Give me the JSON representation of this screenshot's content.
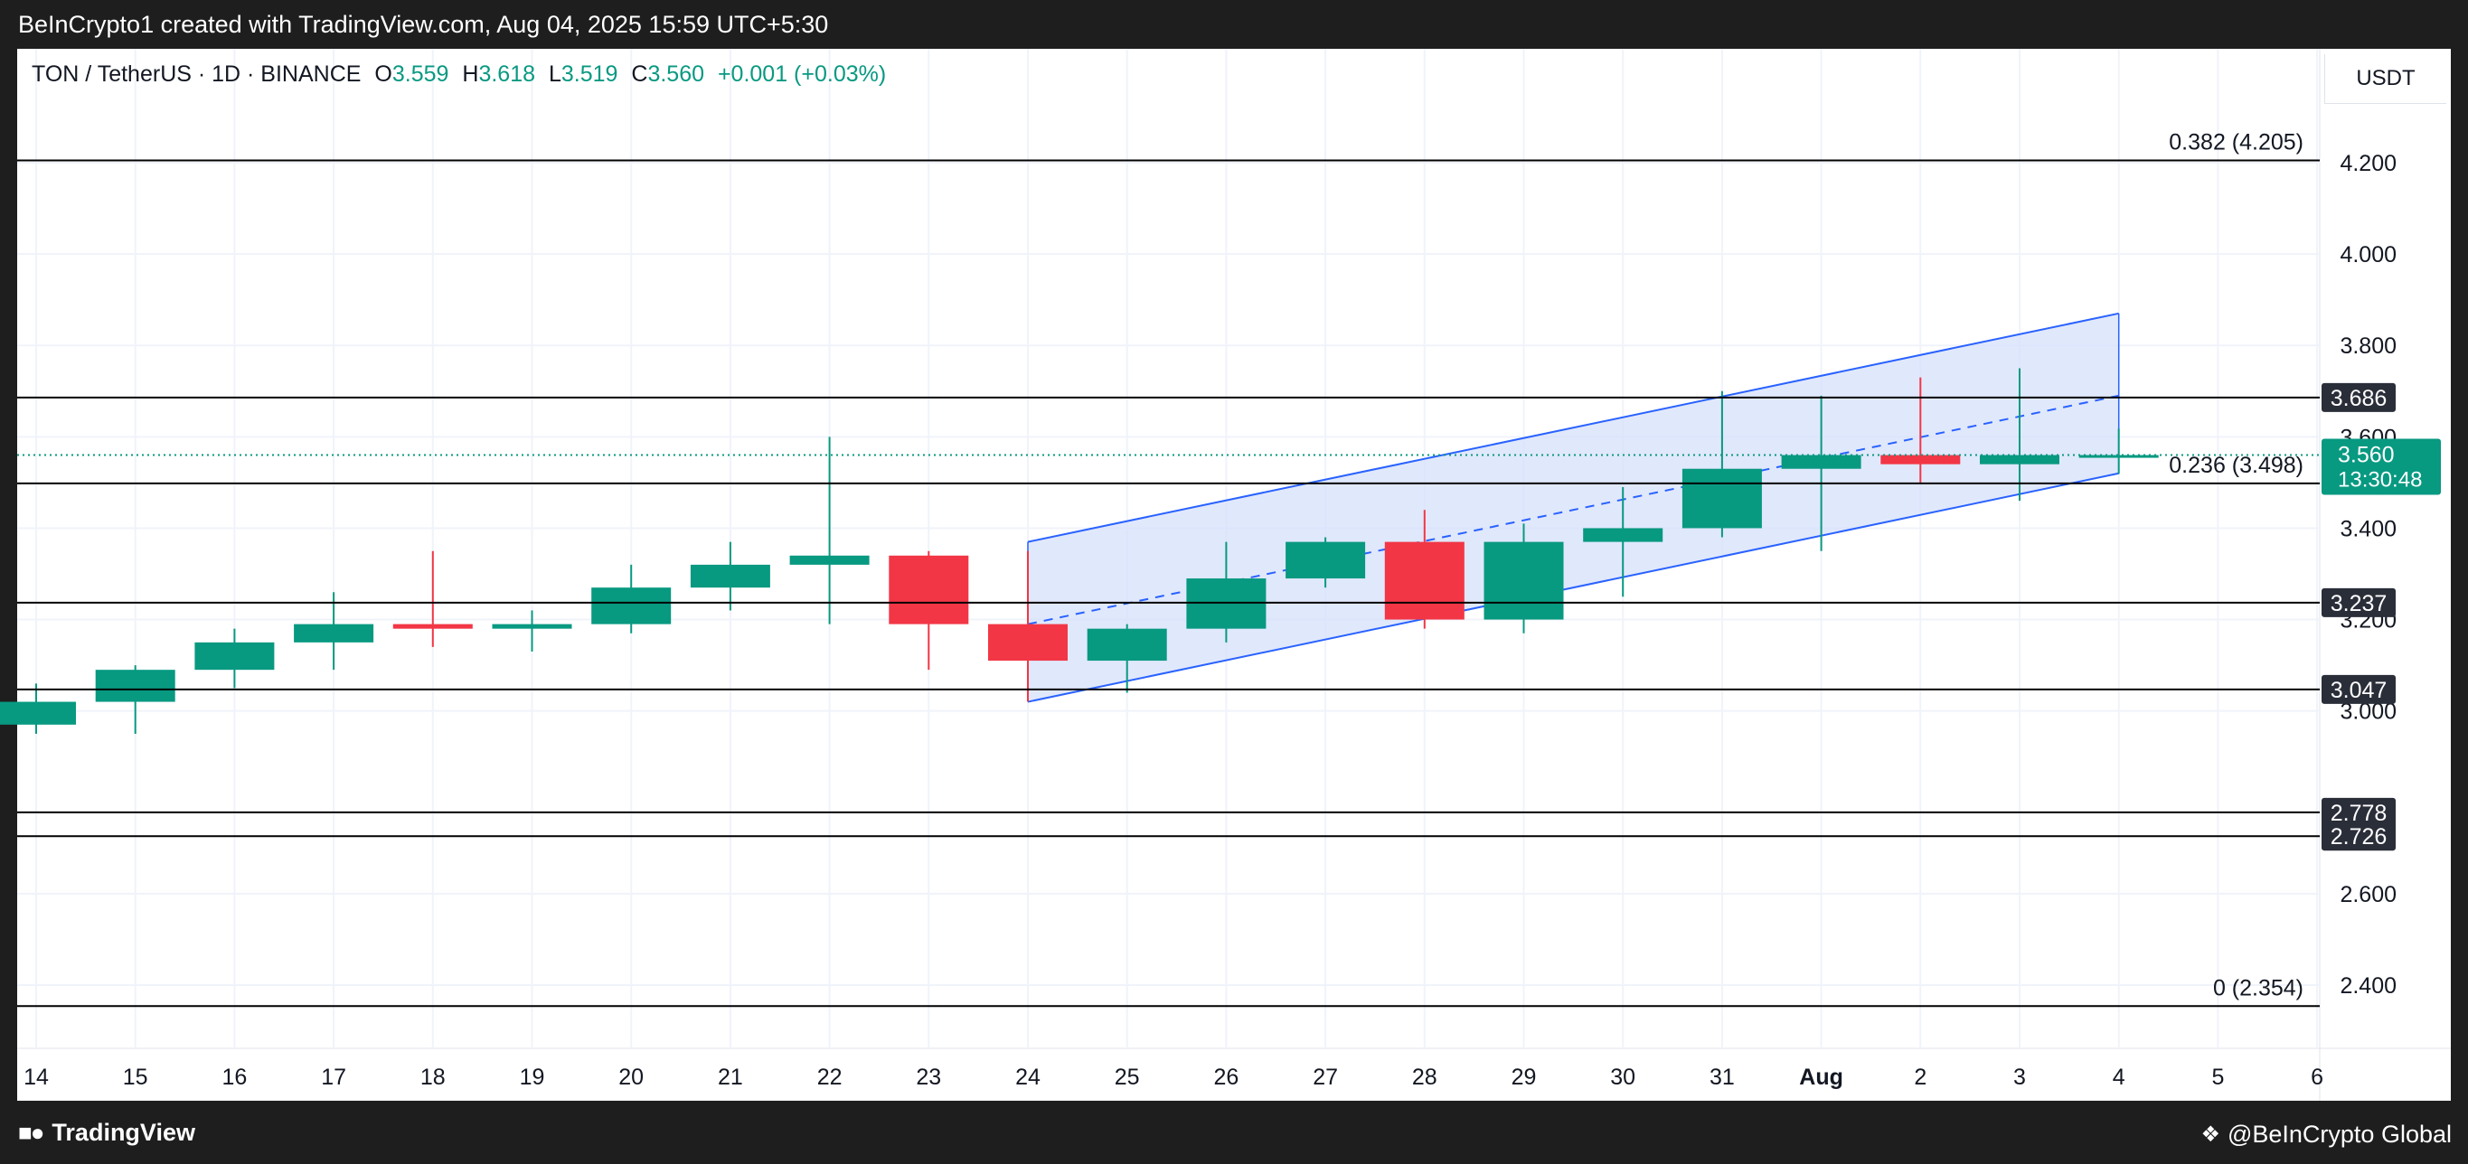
{
  "header": {
    "attribution": "BeInCrypto1 created with TradingView.com, Aug 04, 2025 15:59 UTC+5:30"
  },
  "legend": {
    "symbol": "TON / TetherUS · 1D · BINANCE",
    "o_label": "O",
    "o_value": "3.559",
    "h_label": "H",
    "h_value": "3.618",
    "l_label": "L",
    "l_value": "3.519",
    "c_label": "C",
    "c_value": "3.560",
    "change": "+0.001 (+0.03%)"
  },
  "currency": "USDT",
  "footer": {
    "tradingview": "TradingView",
    "brand": "@BeInCrypto Global"
  },
  "colors": {
    "up": "#089981",
    "down": "#f23645",
    "channel": "#2962ff",
    "channel_fill": "#d6e0fb",
    "level_line": "#000000",
    "badge_dark": "#2a2e39"
  },
  "chart_data": {
    "type": "candlestick",
    "x_labels": [
      "14",
      "15",
      "16",
      "17",
      "18",
      "19",
      "20",
      "21",
      "22",
      "23",
      "24",
      "25",
      "26",
      "27",
      "28",
      "29",
      "30",
      "31",
      "Aug",
      "2",
      "3",
      "4",
      "5",
      "6"
    ],
    "y_ticks": [
      "2.400",
      "2.600",
      "3.000",
      "3.200",
      "3.400",
      "3.600",
      "3.800",
      "4.000",
      "4.200"
    ],
    "ylim": [
      2.23,
      4.55
    ],
    "candles": [
      {
        "x": 0,
        "o": 2.97,
        "h": 3.06,
        "l": 2.95,
        "c": 3.02
      },
      {
        "x": 1,
        "o": 3.02,
        "h": 3.1,
        "l": 2.95,
        "c": 3.09
      },
      {
        "x": 2,
        "o": 3.09,
        "h": 3.18,
        "l": 3.05,
        "c": 3.15
      },
      {
        "x": 3,
        "o": 3.15,
        "h": 3.26,
        "l": 3.09,
        "c": 3.19
      },
      {
        "x": 4,
        "o": 3.19,
        "h": 3.35,
        "l": 3.14,
        "c": 3.18
      },
      {
        "x": 5,
        "o": 3.18,
        "h": 3.22,
        "l": 3.13,
        "c": 3.19
      },
      {
        "x": 6,
        "o": 3.19,
        "h": 3.32,
        "l": 3.17,
        "c": 3.27
      },
      {
        "x": 7,
        "o": 3.27,
        "h": 3.37,
        "l": 3.22,
        "c": 3.32
      },
      {
        "x": 8,
        "o": 3.32,
        "h": 3.6,
        "l": 3.19,
        "c": 3.34
      },
      {
        "x": 9,
        "o": 3.34,
        "h": 3.35,
        "l": 3.09,
        "c": 3.19
      },
      {
        "x": 10,
        "o": 3.19,
        "h": 3.35,
        "l": 3.02,
        "c": 3.11
      },
      {
        "x": 11,
        "o": 3.11,
        "h": 3.19,
        "l": 3.04,
        "c": 3.18
      },
      {
        "x": 12,
        "o": 3.18,
        "h": 3.37,
        "l": 3.15,
        "c": 3.29
      },
      {
        "x": 13,
        "o": 3.29,
        "h": 3.38,
        "l": 3.27,
        "c": 3.37
      },
      {
        "x": 14,
        "o": 3.37,
        "h": 3.44,
        "l": 3.18,
        "c": 3.2
      },
      {
        "x": 15,
        "o": 3.2,
        "h": 3.41,
        "l": 3.17,
        "c": 3.37
      },
      {
        "x": 16,
        "o": 3.37,
        "h": 3.49,
        "l": 3.25,
        "c": 3.4
      },
      {
        "x": 17,
        "o": 3.4,
        "h": 3.7,
        "l": 3.38,
        "c": 3.53
      },
      {
        "x": 18,
        "o": 3.53,
        "h": 3.69,
        "l": 3.35,
        "c": 3.56
      },
      {
        "x": 19,
        "o": 3.56,
        "h": 3.73,
        "l": 3.5,
        "c": 3.54
      },
      {
        "x": 20,
        "o": 3.54,
        "h": 3.75,
        "l": 3.46,
        "c": 3.56
      },
      {
        "x": 21,
        "o": 3.559,
        "h": 3.618,
        "l": 3.519,
        "c": 3.56
      }
    ],
    "horizontal_levels": [
      {
        "value": 4.205,
        "label": "0.382 (4.205)",
        "badge": ""
      },
      {
        "value": 3.686,
        "label": "",
        "badge": "3.686"
      },
      {
        "value": 3.498,
        "label": "0.236 (3.498)",
        "badge": ""
      },
      {
        "value": 3.237,
        "label": "",
        "badge": "3.237"
      },
      {
        "value": 3.047,
        "label": "",
        "badge": "3.047"
      },
      {
        "value": 2.778,
        "label": "",
        "badge": "2.778"
      },
      {
        "value": 2.726,
        "label": "",
        "badge": "2.726"
      },
      {
        "value": 2.354,
        "label": "0 (2.354)",
        "badge": ""
      }
    ],
    "current_price": {
      "value": 3.56,
      "label": "3.560",
      "countdown": "13:30:48"
    },
    "channel": {
      "x_start": 10,
      "x_end": 21,
      "upper": [
        3.37,
        3.87
      ],
      "mid": [
        3.19,
        3.69
      ],
      "lower": [
        3.02,
        3.52
      ]
    },
    "grid": true
  }
}
